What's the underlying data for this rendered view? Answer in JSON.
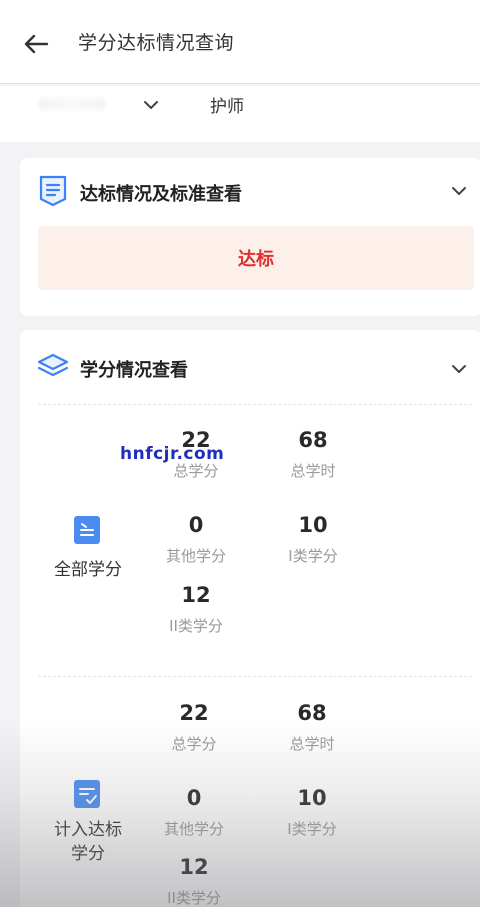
{
  "header": {
    "title": "学分达标情况查询",
    "back_icon": "arrow-left-icon"
  },
  "role_selector": {
    "selected_role": "护师"
  },
  "standard_card": {
    "title": "达标情况及标准查看",
    "status": "达标",
    "status_color": "#e03131",
    "icon": "badge-document-icon"
  },
  "credits_card": {
    "title": "学分情况查看",
    "icon": "layers-icon",
    "groups": [
      {
        "label": "全部学分",
        "icon": "clipboard-list-icon",
        "total_credits": {
          "value": "22",
          "label": "总学分"
        },
        "total_hours": {
          "value": "68",
          "label": "总学时"
        },
        "other_credits": {
          "value": "0",
          "label": "其他学分"
        },
        "class1_credits": {
          "value": "10",
          "label": "I类学分"
        },
        "class2_credits": {
          "value": "12",
          "label": "II类学分"
        }
      },
      {
        "label": "计入达标学分",
        "label_line1": "计入达标",
        "label_line2": "学分",
        "icon": "clipboard-check-icon",
        "total_credits": {
          "value": "22",
          "label": "总学分"
        },
        "total_hours": {
          "value": "68",
          "label": "总学时"
        },
        "other_credits": {
          "value": "0",
          "label": "其他学分"
        },
        "class1_credits": {
          "value": "10",
          "label": "I类学分"
        },
        "class2_credits": {
          "value": "12",
          "label": "II类学分"
        }
      }
    ]
  },
  "watermark": "hnfcjr.com",
  "colors": {
    "accent_blue": "#3b82f6",
    "status_bg": "#fdf0ea"
  }
}
